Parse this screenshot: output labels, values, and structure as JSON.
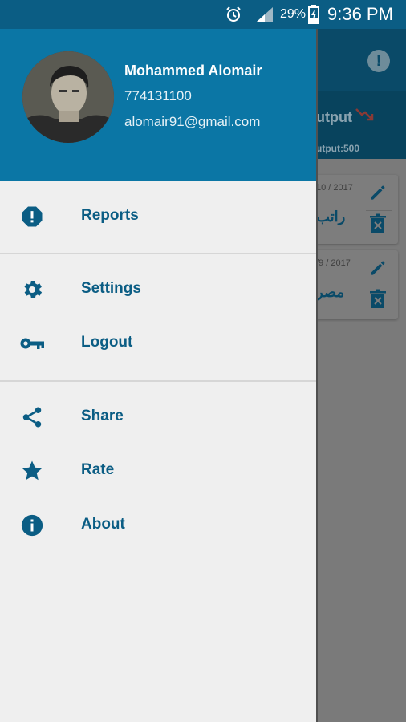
{
  "status_bar": {
    "battery_percent": "29%",
    "time": "9:36 PM",
    "icons": [
      "alarm-icon",
      "signal-icon",
      "battery-charging-icon"
    ]
  },
  "colors": {
    "primary": "#0b76a5",
    "primary_dark": "#0b5d84",
    "menu_text": "#0b5d84",
    "drawer_bg": "#efefef"
  },
  "drawer": {
    "user": {
      "name": "Mohammed Alomair",
      "phone": "774131100",
      "email": "alomair91@gmail.com"
    },
    "sections": [
      {
        "items": [
          {
            "label": "Reports",
            "icon": "report-alert-icon"
          }
        ]
      },
      {
        "items": [
          {
            "label": "Settings",
            "icon": "gear-icon"
          },
          {
            "label": "Logout",
            "icon": "key-icon"
          }
        ]
      },
      {
        "items": [
          {
            "label": "Share",
            "icon": "share-icon"
          },
          {
            "label": "Rate",
            "icon": "star-icon"
          },
          {
            "label": "About",
            "icon": "info-icon"
          }
        ]
      }
    ]
  },
  "background_app": {
    "summary_label": "utput",
    "summary_total": "utput:500",
    "cards": [
      {
        "date": "10 / 2017",
        "title": "راتب"
      },
      {
        "date": "/9 / 2017",
        "title": "مصر"
      }
    ]
  }
}
